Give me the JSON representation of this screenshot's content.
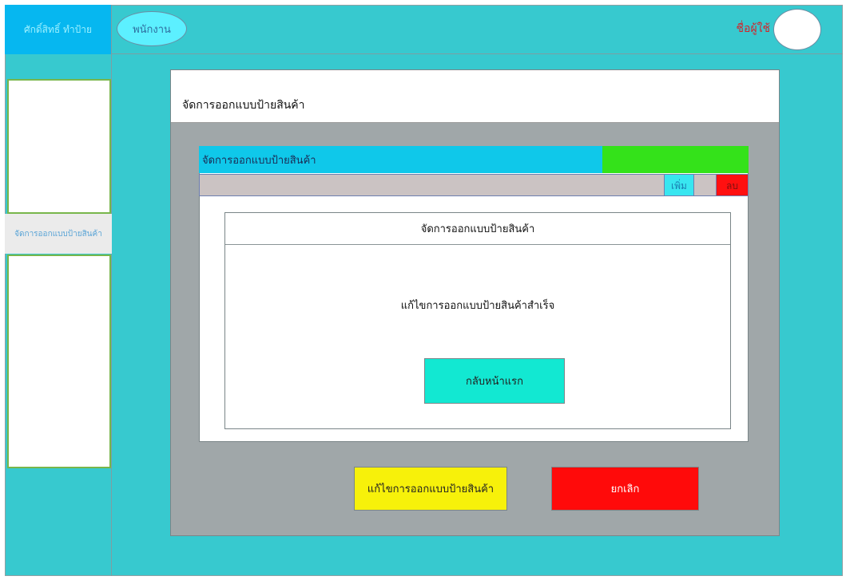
{
  "topbar": {
    "brand": "ศักดิ์สิทธิ์ ทำป้าย",
    "role": "พนักงาน",
    "username": "ชื่อผู้ใช้"
  },
  "sidebar": {
    "menu_item": "จัดการออกแบบป้ายสินค้า"
  },
  "panel": {
    "title": "จัดการออกแบบป้ายสินค้า"
  },
  "card": {
    "header": "จัดการออกแบบป้ายสินค้า",
    "add_label": "เพิ่ม",
    "delete_label": "ลบ"
  },
  "dialog": {
    "title": "จัดการออกแบบป้ายสินค้า",
    "message": "แก้ไขการออกแบบป้ายสินค้าสำเร็จ",
    "home_button": "กลับหน้าแรก"
  },
  "actions": {
    "edit_button": "แก้ไขการออกแบบป้ายสินค้า",
    "cancel_button": "ยกเลิก"
  }
}
